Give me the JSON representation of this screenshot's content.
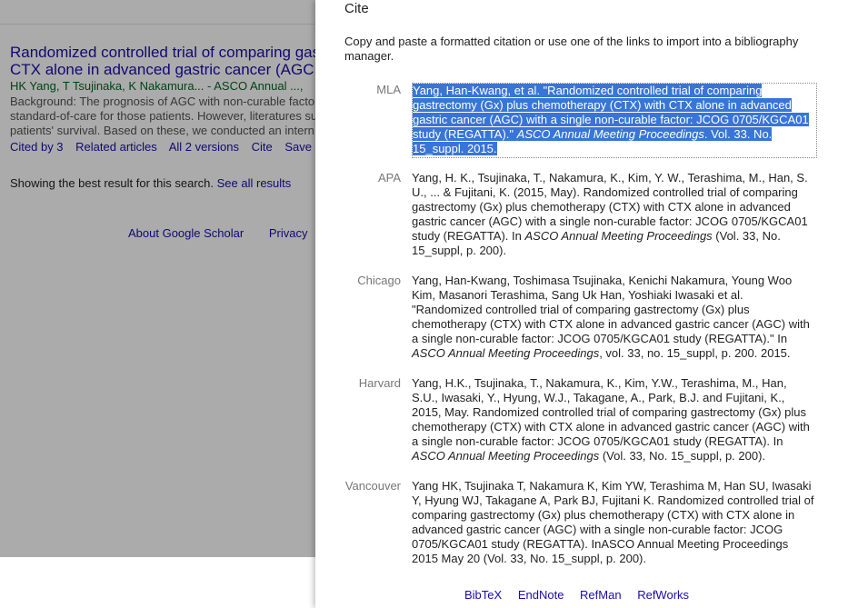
{
  "background_page": {
    "result": {
      "title_line1": "Randomized controlled trial of comparing gas",
      "title_line2": "CTX alone in advanced gastric cancer (AGC",
      "authors": "HK Yang, T Tsujinaka, K Nakamura... - ASCO Annual ...,",
      "snippet_line1": "Background: The prognosis of AGC with non-curable facto",
      "snippet_line2": "standard-of-care for those patients. However, literatures su",
      "snippet_line3": "patients' survival. Based on these, we conducted an intern",
      "links": [
        "Cited by 3",
        "Related articles",
        "All 2 versions",
        "Cite",
        "Save"
      ]
    },
    "best_result_text": "Showing the best result for this search.",
    "see_all_link": "See all results",
    "footer_links": [
      "About Google Scholar",
      "Privacy"
    ]
  },
  "cite_dialog": {
    "title": "Cite",
    "intro": "Copy and paste a formatted citation or use one of the links to import into a bibliography manager.",
    "citations": [
      {
        "style": "MLA",
        "text_before_italic": "Yang, Han-Kwang, et al. \"Randomized controlled trial of comparing gastrectomy (Gx) plus chemotherapy (CTX) with CTX alone in advanced gastric cancer (AGC) with a single non-curable factor: JCOG 0705/KGCA01 study (REGATTA).\" ",
        "italic": "ASCO Annual Meeting Proceedings",
        "text_after_italic": ". Vol. 33. No. 15_suppl. 2015.",
        "selected": true
      },
      {
        "style": "APA",
        "text_before_italic": "Yang, H. K., Tsujinaka, T., Nakamura, K., Kim, Y. W., Terashima, M., Han, S. U., ... & Fujitani, K. (2015, May). Randomized controlled trial of comparing gastrectomy (Gx) plus chemotherapy (CTX) with CTX alone in advanced gastric cancer (AGC) with a single non-curable factor: JCOG 0705/KGCA01 study (REGATTA). In ",
        "italic": "ASCO Annual Meeting Proceedings",
        "text_after_italic": " (Vol. 33, No. 15_suppl, p. 200).",
        "selected": false
      },
      {
        "style": "Chicago",
        "text_before_italic": "Yang, Han-Kwang, Toshimasa Tsujinaka, Kenichi Nakamura, Young Woo Kim, Masanori Terashima, Sang Uk Han, Yoshiaki Iwasaki et al. \"Randomized controlled trial of comparing gastrectomy (Gx) plus chemotherapy (CTX) with CTX alone in advanced gastric cancer (AGC) with a single non-curable factor: JCOG 0705/KGCA01 study (REGATTA).\" In ",
        "italic": "ASCO Annual Meeting Proceedings",
        "text_after_italic": ", vol. 33, no. 15_suppl, p. 200. 2015.",
        "selected": false
      },
      {
        "style": "Harvard",
        "text_before_italic": "Yang, H.K., Tsujinaka, T., Nakamura, K., Kim, Y.W., Terashima, M., Han, S.U., Iwasaki, Y., Hyung, W.J., Takagane, A., Park, B.J. and Fujitani, K., 2015, May. Randomized controlled trial of comparing gastrectomy (Gx) plus chemotherapy (CTX) with CTX alone in advanced gastric cancer (AGC) with a single non-curable factor: JCOG 0705/KGCA01 study (REGATTA). In ",
        "italic": "ASCO Annual Meeting Proceedings",
        "text_after_italic": " (Vol. 33, No. 15_suppl, p. 200).",
        "selected": false
      },
      {
        "style": "Vancouver",
        "text_before_italic": "Yang HK, Tsujinaka T, Nakamura K, Kim YW, Terashima M, Han SU, Iwasaki Y, Hyung WJ, Takagane A, Park BJ, Fujitani K. Randomized controlled trial of comparing gastrectomy (Gx) plus chemotherapy (CTX) with CTX alone in advanced gastric cancer (AGC) with a single non-curable factor: JCOG 0705/KGCA01 study (REGATTA). InASCO Annual Meeting Proceedings 2015 May 20 (Vol. 33, No. 15_suppl, p. 200).",
        "italic": "",
        "text_after_italic": "",
        "selected": false
      }
    ],
    "export_links": [
      "BibTeX",
      "EndNote",
      "RefMan",
      "RefWorks"
    ]
  },
  "colors": {
    "link": "#1a0dab",
    "author_green": "#006621",
    "selection": "#3875d7",
    "label_gray": "#777777"
  }
}
